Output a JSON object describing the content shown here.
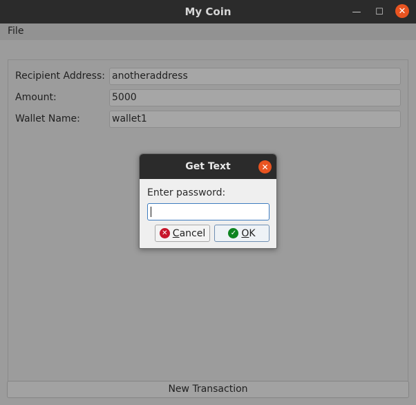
{
  "window": {
    "title": "My Coin",
    "minimize_glyph": "—",
    "maximize_glyph": "☐",
    "close_glyph": "✕"
  },
  "menubar": {
    "file_label": "File"
  },
  "form": {
    "recipient_label": "Recipient Address:",
    "recipient_value": "anotheraddress",
    "amount_label": "Amount:",
    "amount_value": "5000",
    "wallet_label": "Wallet Name:",
    "wallet_value": "wallet1"
  },
  "bottom_button_label": "New Transaction",
  "dialog": {
    "title": "Get Text",
    "close_glyph": "✕",
    "prompt": "Enter password:",
    "input_value": "",
    "cancel_mnemonic": "C",
    "cancel_rest": "ancel",
    "ok_mnemonic": "O",
    "ok_rest": "K",
    "cancel_icon_glyph": "✕",
    "ok_icon_glyph": "✓"
  },
  "colors": {
    "accent_close": "#e95420",
    "cancel_icon": "#c7162b",
    "ok_icon": "#0e8420",
    "focus_border": "#3d7bbf"
  }
}
